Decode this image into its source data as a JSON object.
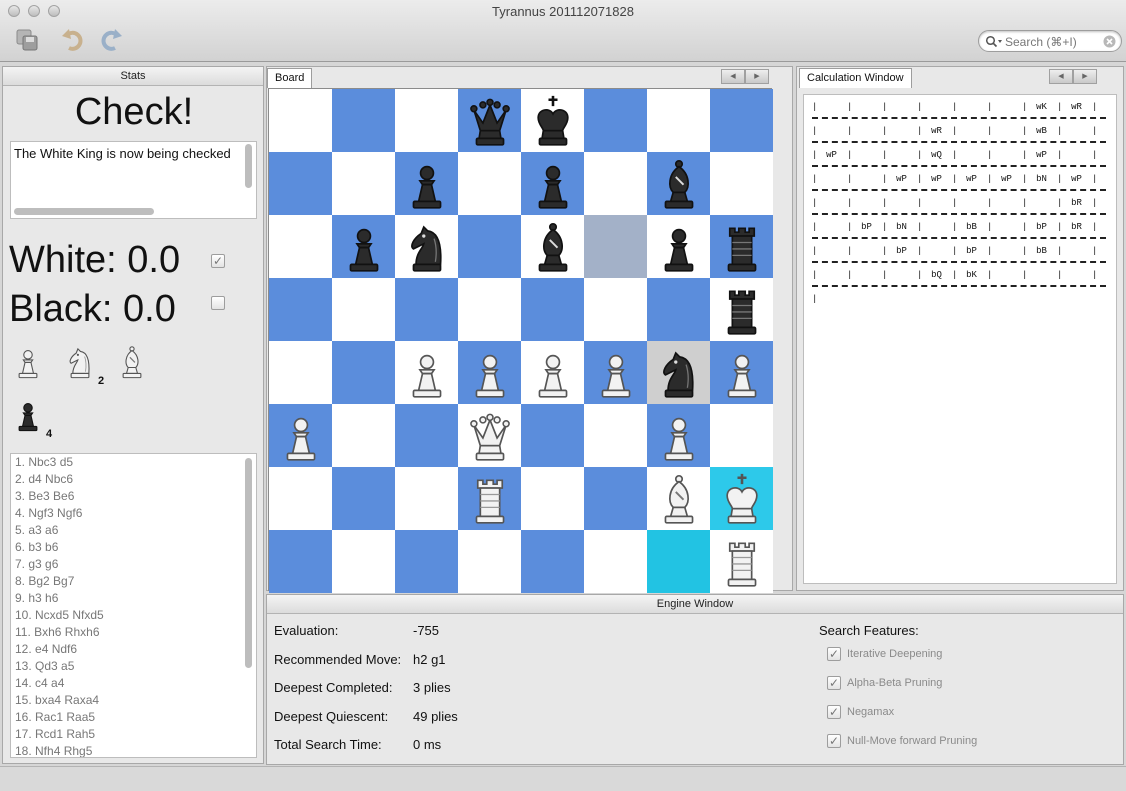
{
  "window": {
    "title": "Tyrannus 201112071828"
  },
  "toolbar": {
    "search": {
      "placeholder": "Search (⌘+I)",
      "value": ""
    }
  },
  "stats": {
    "panel_title": "Stats",
    "headline": "Check!",
    "status_message": "The White King is now being checked",
    "white_score_label": "White:",
    "white_score": "0.0",
    "white_checked": true,
    "black_score_label": "Black:",
    "black_score": "0.0",
    "black_checked": false,
    "captured_white": [
      {
        "piece": "pawn",
        "count": ""
      },
      {
        "piece": "knight",
        "count": "2"
      },
      {
        "piece": "bishop",
        "count": ""
      }
    ],
    "captured_black": [
      {
        "piece": "pawn",
        "count": "4"
      }
    ],
    "moves": [
      "1. Nbc3 d5",
      "2. d4 Nbc6",
      "3. Be3 Be6",
      "4. Ngf3 Ngf6",
      "5. a3 a6",
      "6. b3 b6",
      "7. g3 g6",
      "8. Bg2 Bg7",
      "9. h3 h6",
      "10. Ncxd5 Nfxd5",
      "11. Bxh6 Rhxh6",
      "12. e4 Ndf6",
      "13. Qd3 a5",
      "14. c4 a4",
      "15. bxa4 Raxa4",
      "16. Rac1 Raa5",
      "17. Rcd1 Rah5",
      "18. Nfh4 Rhg5"
    ]
  },
  "board": {
    "tab_label": "Board",
    "light_color": "#ffffff",
    "dark_color": "#5b8ddc",
    "highlight_colors": {
      "last_move_from": "#a3b1c8",
      "last_move_to": "#cfcfcf",
      "check_king": "#2dc9ea",
      "check_path": "#22c3e3"
    },
    "highlights": {
      "f6": "last_move_from",
      "g4": "last_move_to",
      "h2": "check_king",
      "g1": "check_path"
    },
    "position": {
      "d8": "bQ",
      "e8": "bK",
      "c7": "bP",
      "e7": "bP",
      "g7": "bB",
      "b6": "bP",
      "c6": "bN",
      "e6": "bB",
      "g6": "bP",
      "h6": "bR",
      "h5": "bR",
      "c4": "wP",
      "d4": "wP",
      "e4": "wP",
      "f4": "wP",
      "g4": "bN",
      "h4": "wP",
      "a3": "wP",
      "d3": "wQ",
      "g3": "wP",
      "d2": "wR",
      "g2": "wB",
      "h2": "wK",
      "h1": "wR"
    }
  },
  "calculation": {
    "tab_label": "Calculation Window",
    "rows": [
      [
        "",
        "",
        "",
        "",
        "",
        "",
        "wK",
        "wR"
      ],
      [
        "",
        "",
        "",
        "wR",
        "",
        "",
        "wB",
        ""
      ],
      [
        "wP",
        "",
        "",
        "wQ",
        "",
        "",
        "wP",
        ""
      ],
      [
        "",
        "",
        "wP",
        "wP",
        "wP",
        "wP",
        "bN",
        "wP"
      ],
      [
        "",
        "",
        "",
        "",
        "",
        "",
        "",
        "bR"
      ],
      [
        "",
        "bP",
        "bN",
        "",
        "bB",
        "",
        "bP",
        "bR"
      ],
      [
        "",
        "",
        "bP",
        "",
        "bP",
        "",
        "bB",
        ""
      ],
      [
        "",
        "",
        "",
        "bQ",
        "bK",
        "",
        "",
        ""
      ]
    ]
  },
  "engine": {
    "panel_title": "Engine Window",
    "stats": [
      {
        "label": "Evaluation:",
        "value": "-755"
      },
      {
        "label": "Recommended Move:",
        "value": "h2 g1"
      },
      {
        "label": "Deepest Completed:",
        "value": "3 plies"
      },
      {
        "label": "Deepest Quiescent:",
        "value": "49 plies"
      },
      {
        "label": "Total Search Time:",
        "value": "0 ms"
      }
    ],
    "search_features_title": "Search Features:",
    "features": [
      {
        "label": "Iterative Deepening",
        "checked": true
      },
      {
        "label": "Alpha-Beta Pruning",
        "checked": true
      },
      {
        "label": "Negamax",
        "checked": true
      },
      {
        "label": "Null-Move forward Pruning",
        "checked": true
      }
    ]
  }
}
